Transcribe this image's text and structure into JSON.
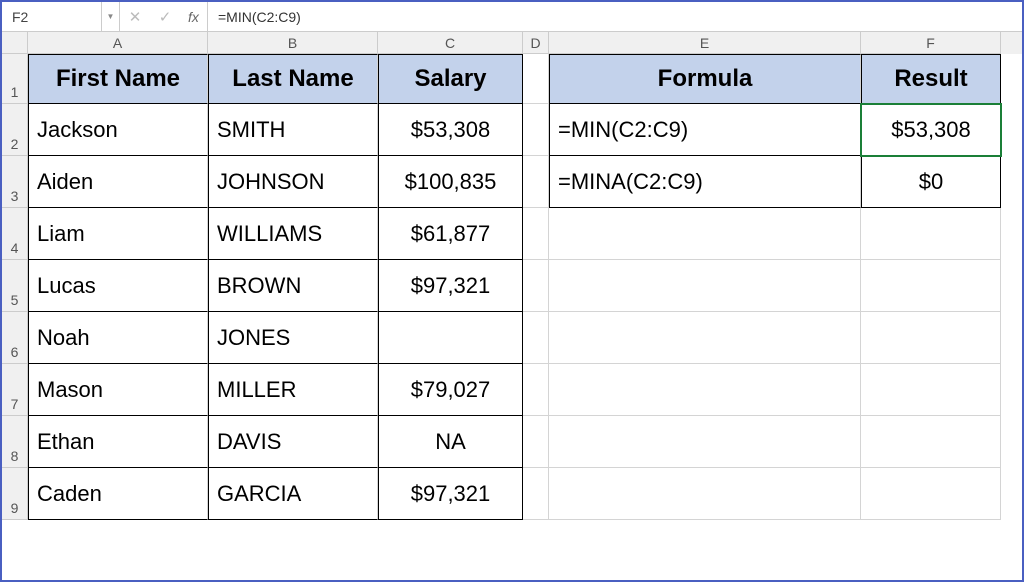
{
  "formula_bar": {
    "name_box": "F2",
    "fx": "fx",
    "formula": "=MIN(C2:C9)"
  },
  "columns": {
    "a": "A",
    "b": "B",
    "c": "C",
    "d": "D",
    "e": "E",
    "f": "F"
  },
  "row_nums": [
    "1",
    "2",
    "3",
    "4",
    "5",
    "6",
    "7",
    "8",
    "9"
  ],
  "headers": {
    "first_name": "First Name",
    "last_name": "Last Name",
    "salary": "Salary",
    "formula": "Formula",
    "result": "Result"
  },
  "data": [
    {
      "first": "Jackson",
      "last": "SMITH",
      "salary": "$53,308"
    },
    {
      "first": "Aiden",
      "last": "JOHNSON",
      "salary": "$100,835"
    },
    {
      "first": "Liam",
      "last": "WILLIAMS",
      "salary": "$61,877"
    },
    {
      "first": "Lucas",
      "last": "BROWN",
      "salary": "$97,321"
    },
    {
      "first": "Noah",
      "last": "JONES",
      "salary": ""
    },
    {
      "first": "Mason",
      "last": "MILLER",
      "salary": "$79,027"
    },
    {
      "first": "Ethan",
      "last": "DAVIS",
      "salary": "NA"
    },
    {
      "first": "Caden",
      "last": "GARCIA",
      "salary": "$97,321"
    }
  ],
  "formulas": [
    {
      "text": "=MIN(C2:C9)",
      "result": "$53,308"
    },
    {
      "text": "=MINA(C2:C9)",
      "result": "$0"
    }
  ]
}
